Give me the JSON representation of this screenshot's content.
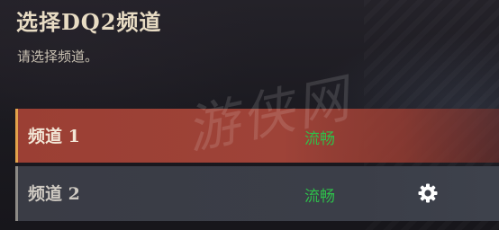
{
  "header": {
    "title": "选择DQ2频道",
    "subtitle": "请选择频道。"
  },
  "watermark": {
    "text": "游侠网"
  },
  "channels": [
    {
      "name": "频道 1",
      "status": "流畅",
      "selected": true
    },
    {
      "name": "频道 2",
      "status": "流畅",
      "selected": false,
      "icon": "settings-gear-icon"
    }
  ],
  "colors": {
    "selected_row": "#9e4338",
    "selected_accent": "#e3a14a",
    "normal_row": "#3b3e48",
    "status_good": "#2ec04a",
    "title": "#e8dcc4"
  }
}
